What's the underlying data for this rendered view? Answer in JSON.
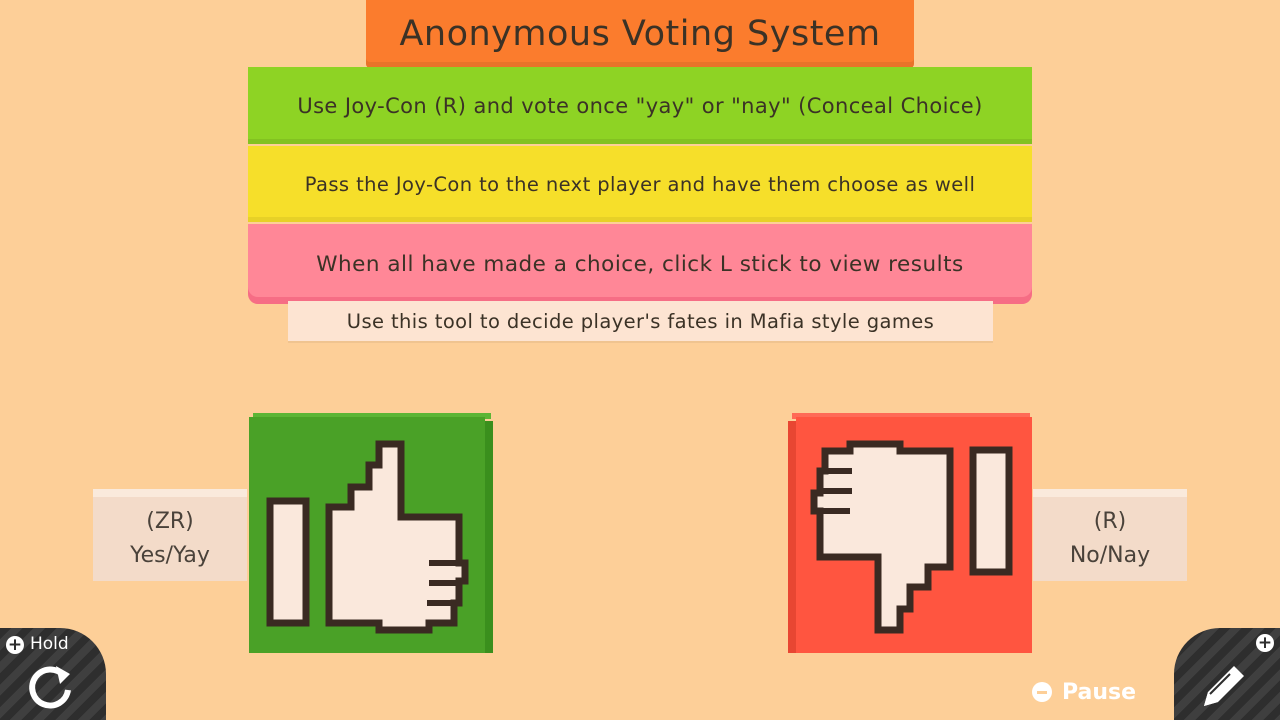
{
  "title": "Anonymous Voting System",
  "instructions": [
    "Use Joy-Con (R) and vote once \"yay\" or \"nay\" (Conceal Choice)",
    "Pass the Joy-Con to the next player and have them choose as well",
    "When all have made a choice, click L stick to view results"
  ],
  "note": "Use this tool to decide player's fates in Mafia style games",
  "yes": {
    "button": "(ZR)",
    "label": "Yes/Yay",
    "icon": "thumbs-up-icon",
    "color": "#4aa127"
  },
  "no": {
    "button": "(R)",
    "label": "No/Nay",
    "icon": "thumbs-down-icon",
    "color": "#ff5540"
  },
  "hud": {
    "hold_label": "Hold",
    "pause_label": "Pause"
  },
  "colors": {
    "background": "#fdcf98",
    "title": "#fb7c2d",
    "step1": "#8ed324",
    "step2": "#f6df2a",
    "step3": "#ff8797"
  }
}
